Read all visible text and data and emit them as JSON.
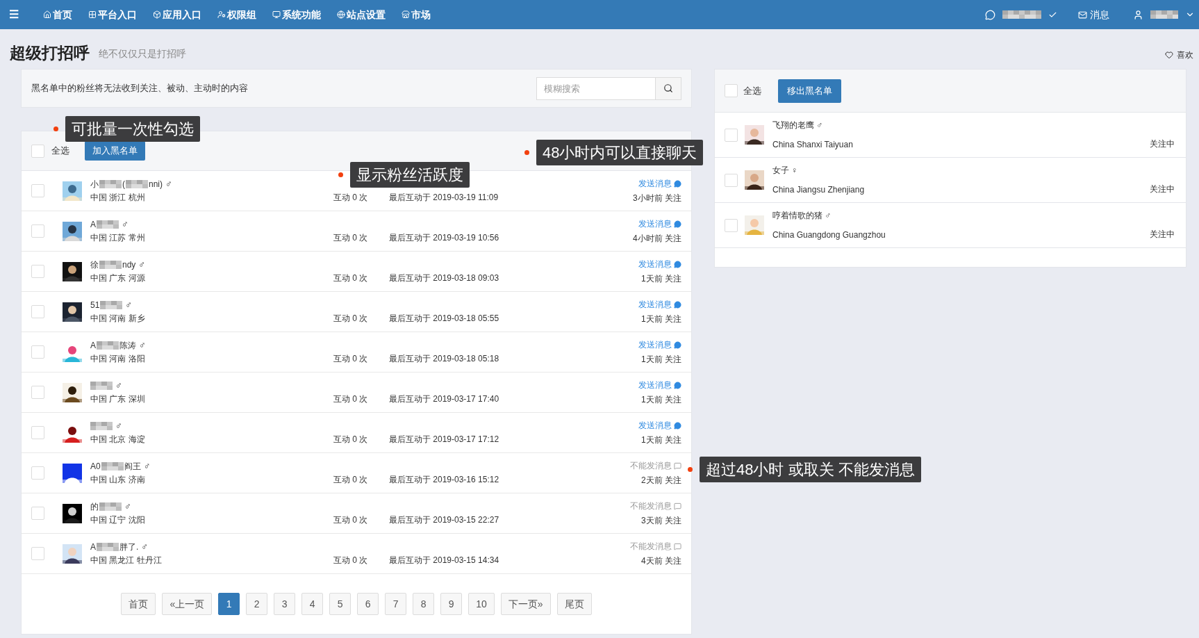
{
  "nav": {
    "menu_icon": "☰",
    "items": [
      "首页",
      "平台入口",
      "应用入口",
      "权限组",
      "系统功能",
      "站点设置",
      "市场"
    ],
    "messages": "消息"
  },
  "header": {
    "title": "超级打招呼",
    "subtitle": "绝不仅仅只是打招呼",
    "like": "喜欢"
  },
  "notice": {
    "text": "黑名单中的粉丝将无法收到关注、被动、主动时的内容",
    "search": {
      "placeholder": "模糊搜索"
    }
  },
  "fans": {
    "select_all": {
      "label": "全选",
      "checked": false
    },
    "action": "加入黑名单",
    "rows": [
      {
        "name_parts": [
          "小",
          "(",
          "nni)"
        ],
        "gender": "♂",
        "location": "中国 浙江 杭州",
        "interactions": "互动 0 次",
        "last": "最后互动于 2019-03-19 11:09",
        "can_message": true,
        "message": "发送消息",
        "followed": "3小时前 关注",
        "checked": false
      },
      {
        "name_parts": [
          "A"
        ],
        "gender": "♂",
        "location": "中国 江苏 常州",
        "interactions": "互动 0 次",
        "last": "最后互动于 2019-03-19 10:56",
        "can_message": true,
        "message": "发送消息",
        "followed": "4小时前 关注",
        "checked": false
      },
      {
        "name_parts": [
          "徐",
          "ndy"
        ],
        "gender": "♂",
        "location": "中国 广东 河源",
        "interactions": "互动 0 次",
        "last": "最后互动于 2019-03-18 09:03",
        "can_message": true,
        "message": "发送消息",
        "followed": "1天前 关注",
        "checked": false
      },
      {
        "name_parts": [
          "51"
        ],
        "gender": "♂",
        "location": "中国 河南 新乡",
        "interactions": "互动 0 次",
        "last": "最后互动于 2019-03-18 05:55",
        "can_message": true,
        "message": "发送消息",
        "followed": "1天前 关注",
        "checked": false
      },
      {
        "name_parts": [
          "A",
          "陈涛"
        ],
        "gender": "♂",
        "location": "中国 河南 洛阳",
        "interactions": "互动 0 次",
        "last": "最后互动于 2019-03-18 05:18",
        "can_message": true,
        "message": "发送消息",
        "followed": "1天前 关注",
        "checked": false
      },
      {
        "gender": "♂",
        "location": "中国 广东 深圳",
        "interactions": "互动 0 次",
        "last": "最后互动于 2019-03-17 17:40",
        "can_message": true,
        "message": "发送消息",
        "followed": "1天前 关注",
        "checked": false
      },
      {
        "gender": "♂",
        "location": "中国 北京 海淀",
        "interactions": "互动 0 次",
        "last": "最后互动于 2019-03-17 17:12",
        "can_message": true,
        "message": "发送消息",
        "followed": "1天前 关注",
        "checked": false
      },
      {
        "name_parts": [
          "A0",
          "阎王"
        ],
        "gender": "♂",
        "location": "中国 山东 济南",
        "interactions": "互动 0 次",
        "last": "最后互动于 2019-03-16 15:12",
        "can_message": false,
        "message": "不能发消息",
        "followed": "2天前 关注",
        "checked": false
      },
      {
        "name_parts": [
          "的"
        ],
        "gender": "♂",
        "location": "中国 辽宁 沈阳",
        "interactions": "互动 0 次",
        "last": "最后互动于 2019-03-15 22:27",
        "can_message": false,
        "message": "不能发消息",
        "followed": "3天前 关注",
        "checked": false
      },
      {
        "name_parts": [
          "A",
          "胖了."
        ],
        "gender": "♂",
        "location": "中国 黑龙江 牡丹江",
        "interactions": "互动 0 次",
        "last": "最后互动于 2019-03-15 14:34",
        "can_message": false,
        "message": "不能发消息",
        "followed": "4天前 关注",
        "checked": false
      }
    ],
    "pagination": [
      {
        "label": "首页",
        "selected": false
      },
      {
        "label": "«上一页",
        "selected": false
      },
      {
        "label": "1",
        "selected": true
      },
      {
        "label": "2",
        "selected": false
      },
      {
        "label": "3",
        "selected": false
      },
      {
        "label": "4",
        "selected": false
      },
      {
        "label": "5",
        "selected": false
      },
      {
        "label": "6",
        "selected": false
      },
      {
        "label": "7",
        "selected": false
      },
      {
        "label": "8",
        "selected": false
      },
      {
        "label": "9",
        "selected": false
      },
      {
        "label": "10",
        "selected": false
      },
      {
        "label": "下一页»",
        "selected": false
      },
      {
        "label": "尾页",
        "selected": false
      }
    ]
  },
  "blacklist": {
    "select_all": {
      "label": "全选",
      "checked": false
    },
    "action": "移出黑名单",
    "rows": [
      {
        "name": "飞翔的老鹰 ♂",
        "location": "China Shanxi Taiyuan",
        "status": "关注中",
        "checked": false
      },
      {
        "name": "女子 ♀",
        "location": "China Jiangsu Zhenjiang",
        "status": "关注中",
        "checked": false
      },
      {
        "name": "哼着情歌的猪 ♂",
        "location": "China Guangdong Guangzhou",
        "status": "关注中",
        "checked": false
      }
    ]
  },
  "annotations": [
    "可批量一次性勾选",
    "显示粉丝活跃度",
    "48小时内可以直接聊天",
    "超过48小时 或取关 不能发消息"
  ]
}
